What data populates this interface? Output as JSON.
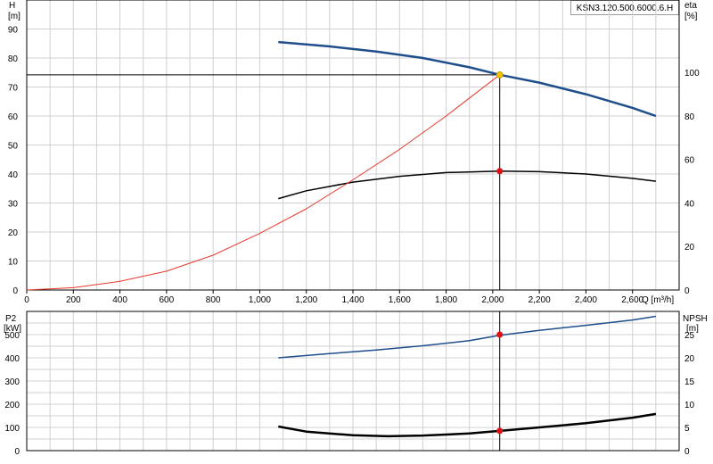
{
  "model_label": "KSN3.120.500.6000.6.H",
  "chart_data": [
    {
      "type": "line",
      "ylabel_left": "H",
      "yunit_left": "[m]",
      "ylabel_right": "eta",
      "yunit_right": "[%]",
      "xlabel": "Q [m³/h]",
      "xlim": [
        0,
        2800
      ],
      "ylim": [
        0,
        100
      ],
      "ylim_right": [
        0,
        133.33
      ],
      "x_ticks": [
        "0",
        "200",
        "400",
        "600",
        "800",
        "1,000",
        "1,200",
        "1,400",
        "1,600",
        "1,800",
        "2,000",
        "2,200",
        "2,400",
        "2,600"
      ],
      "x_tick_values": [
        0,
        200,
        400,
        600,
        800,
        1000,
        1200,
        1400,
        1600,
        1800,
        2000,
        2200,
        2400,
        2600
      ],
      "y_ticks_left": [
        "0",
        "10",
        "20",
        "30",
        "40",
        "50",
        "60",
        "70",
        "80",
        "90"
      ],
      "y_tick_values_left": [
        0,
        10,
        20,
        30,
        40,
        50,
        60,
        70,
        80,
        90
      ],
      "y_ticks_right": [
        "0",
        "20",
        "40",
        "60",
        "80",
        "100"
      ],
      "y_tick_values_right": [
        0,
        20,
        40,
        60,
        80,
        100
      ],
      "grid": true,
      "series": [
        {
          "id": "head",
          "axis": "left",
          "color": "#1f4e8c",
          "width": 2.5,
          "x": [
            1080,
            1300,
            1500,
            1700,
            1900,
            2030,
            2200,
            2400,
            2600,
            2700
          ],
          "y": [
            85.5,
            84.0,
            82.2,
            80.0,
            76.8,
            74.2,
            71.5,
            67.5,
            62.8,
            60.0
          ]
        },
        {
          "id": "efficiency",
          "axis": "left",
          "color": "#000000",
          "width": 1.5,
          "x": [
            1080,
            1200,
            1400,
            1600,
            1800,
            2030,
            2200,
            2400,
            2600,
            2700
          ],
          "y": [
            31.5,
            34.2,
            37.2,
            39.2,
            40.5,
            41.0,
            40.8,
            40.0,
            38.5,
            37.5
          ]
        },
        {
          "id": "system_curve",
          "axis": "left",
          "color": "#e63a2e",
          "width": 1,
          "x": [
            0,
            200,
            400,
            600,
            800,
            1000,
            1200,
            1400,
            1600,
            1800,
            2030
          ],
          "y": [
            0,
            0.8,
            3.0,
            6.5,
            12.0,
            19.5,
            28.0,
            38.0,
            48.5,
            60.0,
            74.2
          ]
        }
      ],
      "duty_point": {
        "x": 2030,
        "y": 74.2,
        "color": "#f5c000"
      },
      "eta_point": {
        "x": 2030,
        "y": 41.0,
        "color": "#e01010"
      }
    },
    {
      "type": "line",
      "ylabel_left": "P2",
      "yunit_left": "[kW]",
      "ylabel_right": "NPSH",
      "yunit_right": "[m]",
      "xlim": [
        0,
        2800
      ],
      "ylim": [
        0,
        600
      ],
      "ylim_right": [
        0,
        30
      ],
      "y_ticks_left": [
        "0",
        "100",
        "200",
        "300",
        "400",
        "500"
      ],
      "y_tick_values_left": [
        0,
        100,
        200,
        300,
        400,
        500
      ],
      "y_ticks_right": [
        "0",
        "5",
        "10",
        "15",
        "20",
        "25"
      ],
      "y_tick_values_right": [
        0,
        5,
        10,
        15,
        20,
        25
      ],
      "grid": true,
      "series": [
        {
          "id": "power",
          "axis": "left",
          "color": "#1f4e8c",
          "width": 1.5,
          "x": [
            1080,
            1300,
            1500,
            1700,
            1900,
            2030,
            2200,
            2400,
            2600,
            2700
          ],
          "y": [
            400,
            418,
            434,
            452,
            474,
            497,
            518,
            540,
            563,
            579
          ]
        },
        {
          "id": "npsh",
          "axis": "left",
          "color": "#000000",
          "width": 2.5,
          "x": [
            1080,
            1200,
            1400,
            1550,
            1700,
            1900,
            2030,
            2200,
            2400,
            2600,
            2700
          ],
          "y": [
            104,
            82,
            66,
            62,
            65,
            74,
            85,
            100,
            118,
            142,
            158
          ]
        }
      ],
      "points": [
        {
          "x": 2030,
          "y": 500,
          "color": "#e01010"
        },
        {
          "x": 2030,
          "y": 85,
          "color": "#e01010"
        }
      ]
    }
  ]
}
